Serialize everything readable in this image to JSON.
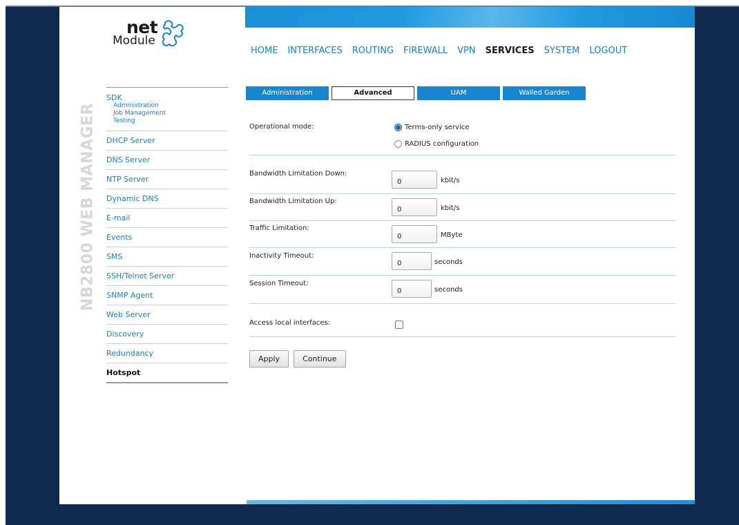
{
  "brand": {
    "logo_net": "net",
    "logo_module": "Module",
    "vertical_title": "NB2800 WEB MANAGER"
  },
  "nav": {
    "items": [
      {
        "label": "HOME"
      },
      {
        "label": "INTERFACES"
      },
      {
        "label": "ROUTING"
      },
      {
        "label": "FIREWALL"
      },
      {
        "label": "VPN"
      },
      {
        "label": "SERVICES",
        "active": true
      },
      {
        "label": "SYSTEM"
      },
      {
        "label": "LOGOUT"
      }
    ]
  },
  "sidebar": {
    "sdk": {
      "label": "SDK",
      "sub": [
        "Administration",
        "Job Management",
        "Testing"
      ]
    },
    "items": [
      "DHCP Server",
      "DNS Server",
      "NTP Server",
      "Dynamic DNS",
      "E-mail",
      "Events",
      "SMS",
      "SSH/Telnet Server",
      "SNMP Agent",
      "Web Server",
      "Discovery",
      "Redundancy",
      "Hotspot"
    ],
    "active": "Hotspot"
  },
  "tabs": [
    {
      "label": "Administration"
    },
    {
      "label": "Advanced",
      "active": true
    },
    {
      "label": "UAM"
    },
    {
      "label": "Walled Garden"
    }
  ],
  "form": {
    "operational_mode": {
      "label": "Operational mode:",
      "options": [
        "Terms-only service",
        "RADIUS configuration"
      ],
      "selected": "Terms-only service"
    },
    "bw_down": {
      "label": "Bandwidth Limitation Down:",
      "value": "0",
      "unit": "kbit/s"
    },
    "bw_up": {
      "label": "Bandwidth Limitation Up:",
      "value": "0",
      "unit": "kbit/s"
    },
    "traffic": {
      "label": "Traffic Limitation:",
      "value": "0",
      "unit": "MByte"
    },
    "inactivity": {
      "label": "Inactivity Timeout:",
      "value": "0",
      "unit": "seconds"
    },
    "session": {
      "label": "Session Timeout:",
      "value": "0",
      "unit": "seconds"
    },
    "access_local": {
      "label": "Access local interfaces:",
      "checked": false
    }
  },
  "buttons": {
    "apply": "Apply",
    "continue": "Continue"
  },
  "colors": {
    "accent": "#1a7fc6",
    "header_band": "#1a8fd8",
    "frame": "#0f2a4d"
  }
}
